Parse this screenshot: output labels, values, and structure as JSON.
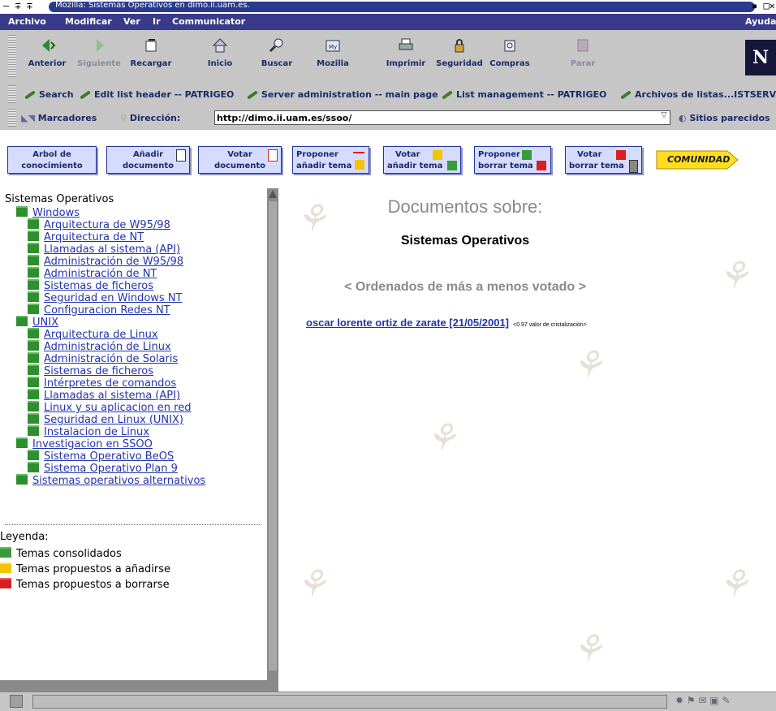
{
  "window": {
    "title": "Mozilla: Sistemas Operativos en dimo.ii.uam.es."
  },
  "menubar": {
    "archivo": "Archivo",
    "modificar": "Modificar",
    "ver": "Ver",
    "ir": "Ir",
    "communicator": "Communicator",
    "ayuda": "Ayuda"
  },
  "toolbar": {
    "anterior": "Anterior",
    "siguiente": "Siguiente",
    "recargar": "Recargar",
    "inicio": "Inicio",
    "buscar": "Buscar",
    "mozilla": "Mozilla",
    "imprimir": "Imprimir",
    "seguridad": "Seguridad",
    "compras": "Compras",
    "parar": "Parar",
    "logo": "N"
  },
  "personal": {
    "search": "Search",
    "edit_list": "Edit list header -- PATRIGEO",
    "server_admin": "Server administration -- main page",
    "list_mgmt": "List management -- PATRIGEO",
    "archivos": "Archivos de listas...ISTSERV."
  },
  "location": {
    "marcadores": "Marcadores",
    "direccion_label": "Dirección:",
    "url": "http://dimo.ii.uam.es/ssoo/",
    "sitios": "Sitios parecidos"
  },
  "nav": {
    "arbol_1": "Arbol de",
    "arbol_2": "conocimiento",
    "anadir_1": "Añadir",
    "anadir_2": "documento",
    "votar_doc_1": "Votar",
    "votar_doc_2": "documento",
    "prop_add_1": "Proponer",
    "prop_add_2": "añadir tema",
    "votar_add_1": "Votar",
    "votar_add_2": "añadir tema",
    "prop_del_1": "Proponer",
    "prop_del_2": "borrar tema",
    "votar_del_1": "Votar",
    "votar_del_2": "borrar tema",
    "comunidad": "COMUNIDAD"
  },
  "tree": {
    "root": "Sistemas Operativos",
    "windows": "Windows",
    "w1": "Arquitectura de W95/98",
    "w2": "Arquitectura de NT",
    "w3": "Llamadas al sistema (API)",
    "w4": "Administración de W95/98",
    "w5": "Administración de NT",
    "w6": "Sistemas de ficheros",
    "w7": "Seguridad en Windows NT",
    "w8": "Configuracion Redes NT",
    "unix": "UNIX",
    "u1": "Arquitectura de Linux",
    "u2": "Administración de Linux",
    "u3": "Administración de Solaris",
    "u4": "Sistemas de ficheros",
    "u5": "Intérpretes de comandos",
    "u6": "Llamadas al sistema (API)",
    "u7": "Linux y su aplicacion en red",
    "u8": "Seguridad en Linux (UNIX)",
    "u9": "Instalacion de Linux",
    "inv": "Investigacion en SSOO",
    "i1": "Sistema Operativo BeOS",
    "i2": "Sistema Operativo Plan 9",
    "alt": "Sistemas operativos alternativos"
  },
  "legend": {
    "title": "Leyenda:",
    "consolidados": "Temas consolidados",
    "anadirse": "Temas propuestos a añadirse",
    "borrarse": "Temas propuestos a borrarse"
  },
  "main": {
    "heading": "Documentos sobre:",
    "topic": "Sistemas Operativos",
    "order": "< Ordenados de más a menos votado >",
    "doc_link": "oscar lorente ortiz de zarate [21/05/2001]",
    "doc_value": "<0.97 valor de cristalización>"
  },
  "colors": {
    "green": "#3a9a3a",
    "yellow": "#f3c500",
    "red": "#d82020",
    "link": "#2233aa"
  }
}
